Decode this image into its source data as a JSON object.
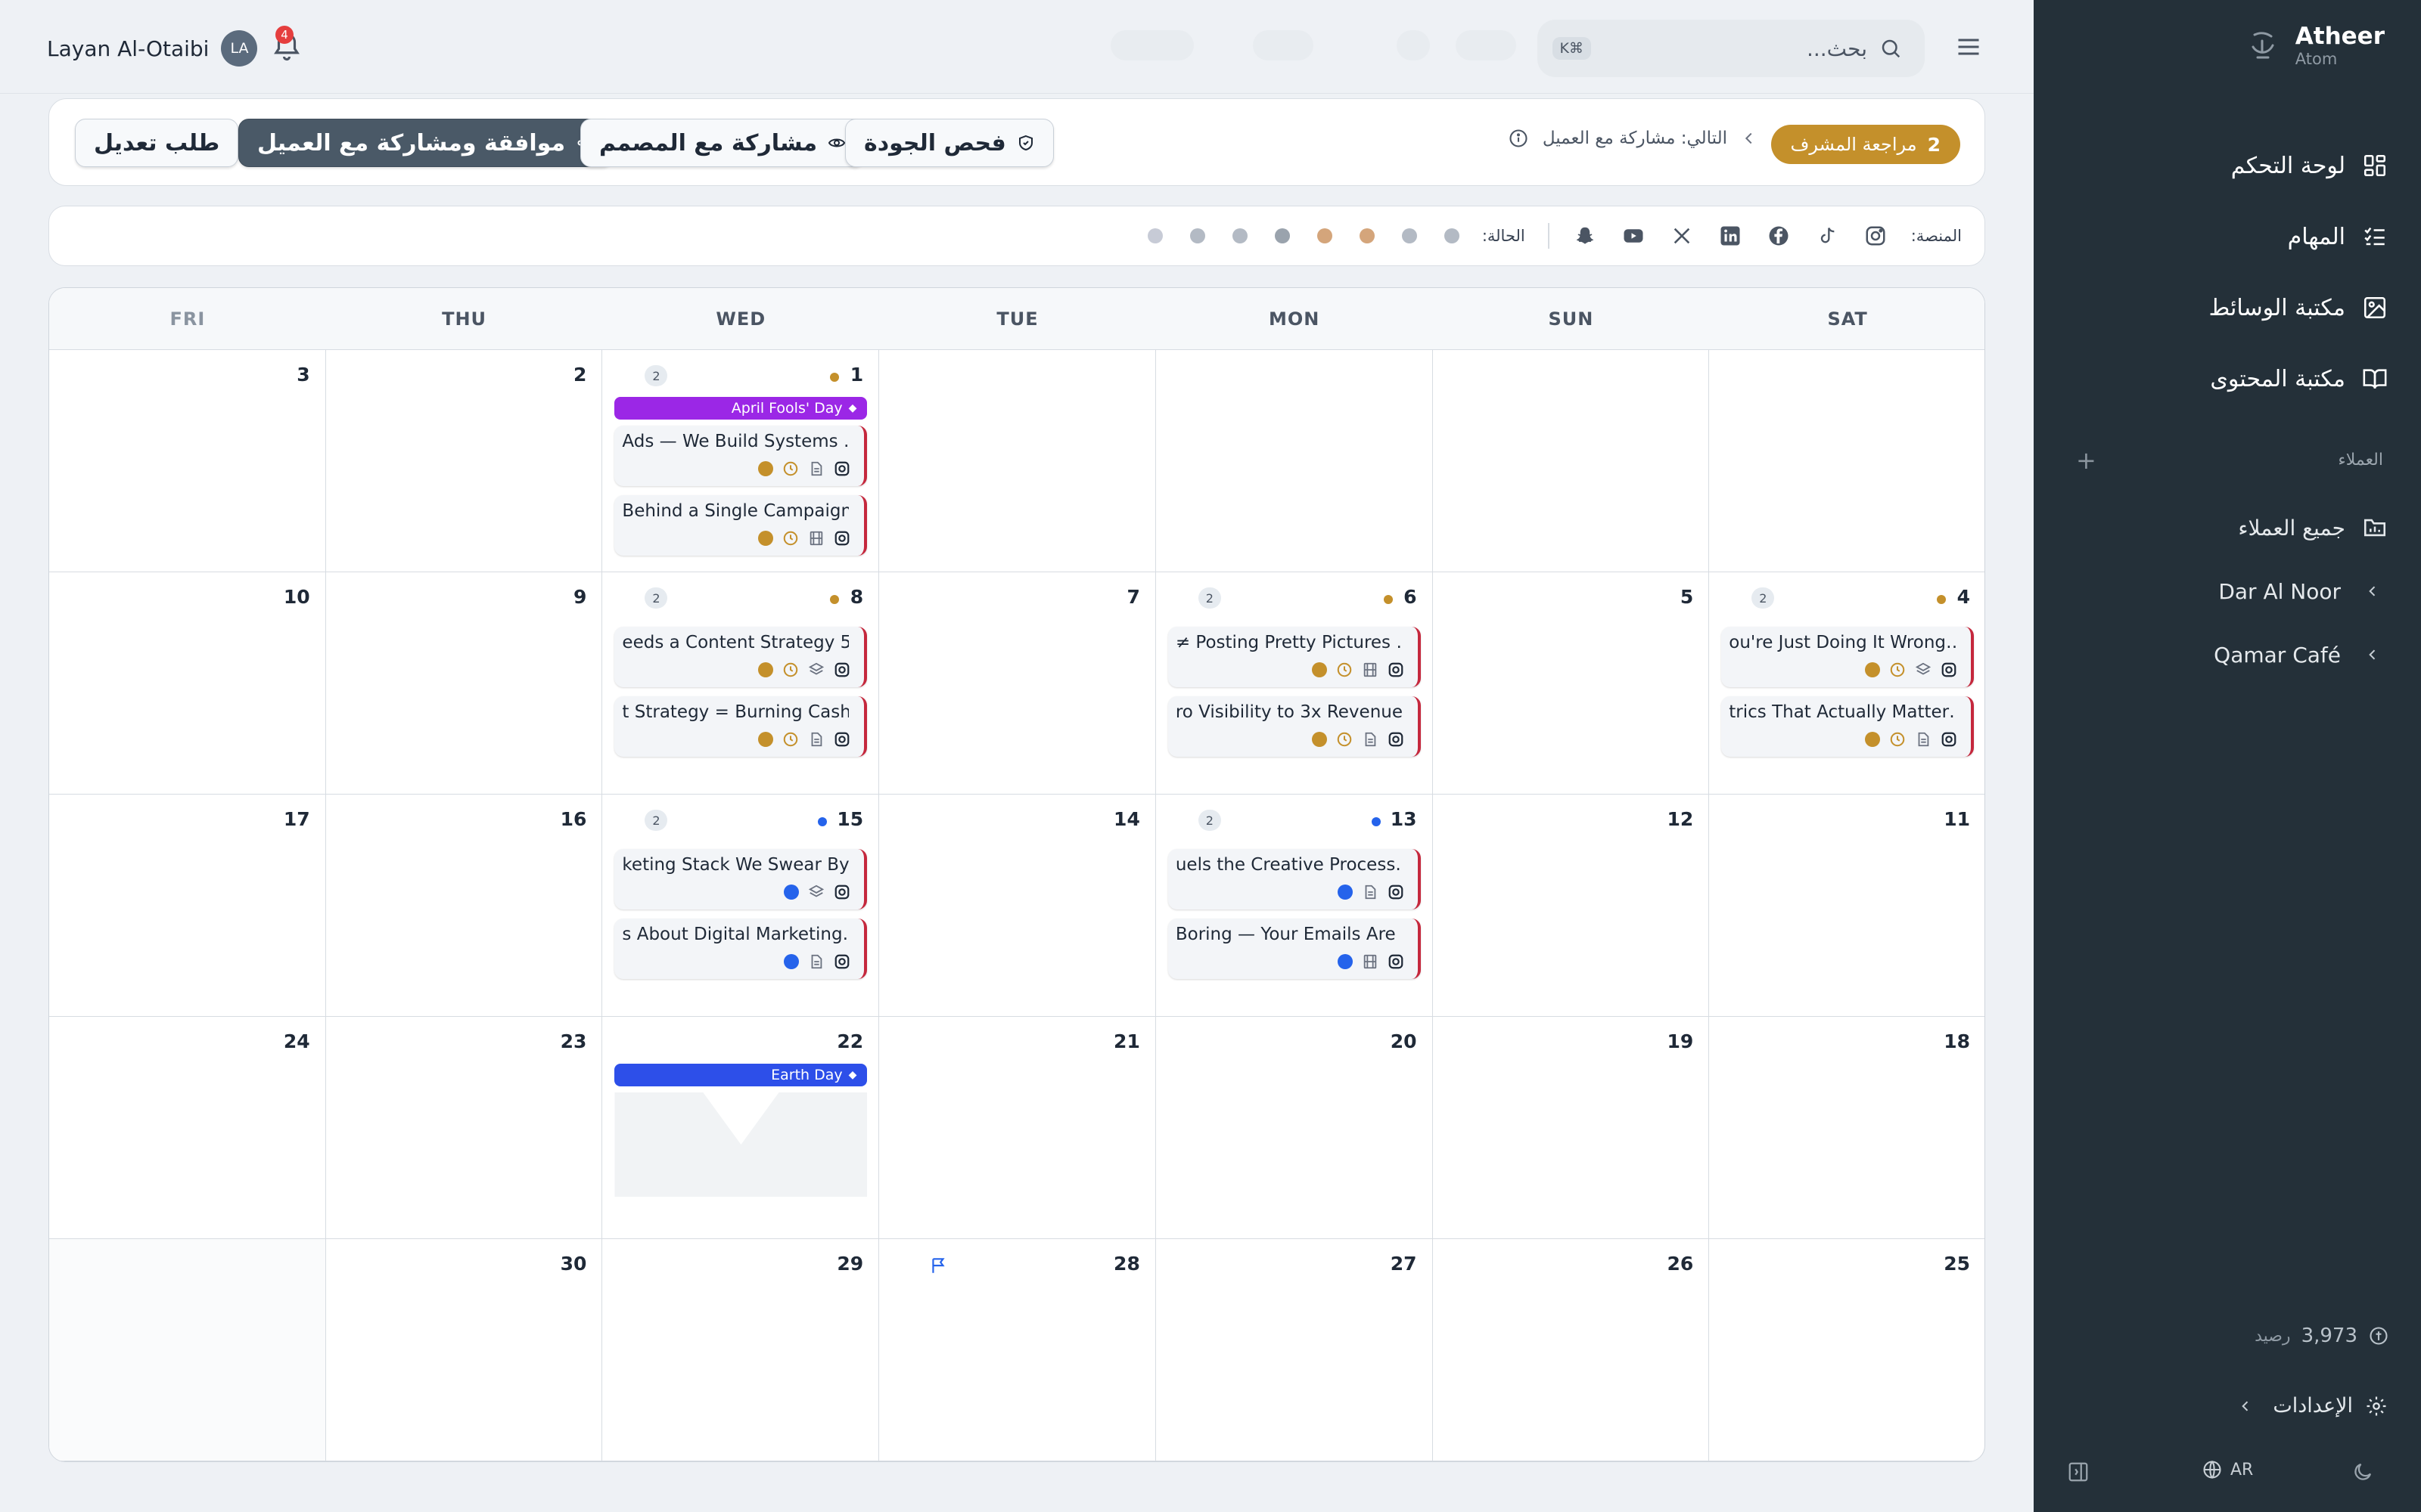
{
  "app": {
    "name": "Atheer",
    "sub": "Atom"
  },
  "nav": [
    "لوحة التحكم",
    "المهام",
    "مكتبة الوسائط",
    "مكتبة المحتوى"
  ],
  "clients_label": "العملاء",
  "clients": [
    "جميع العملاء",
    "Dar Al Noor",
    "Qamar Café"
  ],
  "credit": {
    "value": "3,973",
    "label": "رصيد"
  },
  "settings": "الإعدادات",
  "lang": "AR",
  "user": {
    "name": "Layan Al-Otaibi",
    "initials": "LA",
    "notifications": "4"
  },
  "search": {
    "placeholder": "بحث...",
    "shortcut": "⌘K"
  },
  "workflow": {
    "stage_num": "2",
    "stage_label": "مراجعة المشرف",
    "next": "التالي: مشاركة مع العميل",
    "buttons": {
      "qc": "فحص الجودة",
      "share_designer": "مشاركة مع المصمم",
      "approve": "موافقة ومشاركة مع العميل",
      "revision": "طلب تعديل"
    }
  },
  "filters": {
    "platform_label": "المنصة:",
    "status_label": "الحالة:"
  },
  "status_colors": [
    "#b3bac4",
    "#b3bac4",
    "#d4a57b",
    "#d4a57b",
    "#9aa3ad",
    "#b3bac4",
    "#b3bac4",
    "#c7cbd6"
  ],
  "days": [
    "SAT",
    "SUN",
    "MON",
    "TUE",
    "WED",
    "THU",
    "FRI"
  ],
  "colors": {
    "gold": "#c4902b",
    "blue": "#2563eb",
    "purple": "#9b27e6",
    "holiday_blue": "#2d4fe9"
  },
  "weeks": [
    [
      {
        "d": ""
      },
      {
        "d": ""
      },
      {
        "d": ""
      },
      {
        "d": ""
      },
      {
        "d": "1",
        "dot": "gold",
        "count": "2",
        "holiday": {
          "label": "April Fools' Day",
          "color": "purple"
        },
        "posts": [
          {
            "t": "Ads — We Build Systems …",
            "m": "doc",
            "c": "gold",
            "clock": true
          },
          {
            "t": "Behind a Single Campaign…",
            "m": "film",
            "c": "gold",
            "clock": true
          }
        ]
      },
      {
        "d": "2"
      },
      {
        "d": "3"
      }
    ],
    [
      {
        "d": "4",
        "dot": "gold",
        "count": "2",
        "posts": [
          {
            "t": "ou're Just Doing It Wrong…",
            "m": "layers",
            "c": "gold",
            "clock": true
          },
          {
            "t": "trics That Actually Matter…",
            "m": "doc",
            "c": "gold",
            "clock": true
          }
        ]
      },
      {
        "d": "5"
      },
      {
        "d": "6",
        "dot": "gold",
        "count": "2",
        "posts": [
          {
            "t": "≠ Posting Pretty Pictures …",
            "m": "film",
            "c": "gold",
            "clock": true
          },
          {
            "t": "ro Visibility to 3x Revenue…",
            "m": "doc",
            "c": "gold",
            "clock": true
          }
        ]
      },
      {
        "d": "7"
      },
      {
        "d": "8",
        "dot": "gold",
        "count": "2",
        "posts": [
          {
            "t": "eeds a Content Strategy 5…",
            "m": "layers",
            "c": "gold",
            "clock": true
          },
          {
            "t": "t Strategy = Burning Cash…",
            "m": "doc",
            "c": "gold",
            "clock": true
          }
        ]
      },
      {
        "d": "9"
      },
      {
        "d": "10"
      }
    ],
    [
      {
        "d": "11"
      },
      {
        "d": "12"
      },
      {
        "d": "13",
        "dot": "blue",
        "count": "2",
        "posts": [
          {
            "t": "uels the Creative Process…",
            "m": "doc",
            "c": "blue",
            "clock": false
          },
          {
            "t": "Boring — Your Emails Are …",
            "m": "film",
            "c": "blue",
            "clock": false
          }
        ]
      },
      {
        "d": "14"
      },
      {
        "d": "15",
        "dot": "blue",
        "count": "2",
        "posts": [
          {
            "t": "keting Stack We Swear By…",
            "m": "layers",
            "c": "blue",
            "clock": false
          },
          {
            "t": "s About Digital Marketing…",
            "m": "doc",
            "c": "blue",
            "clock": false
          }
        ]
      },
      {
        "d": "16"
      },
      {
        "d": "17"
      }
    ],
    [
      {
        "d": "18"
      },
      {
        "d": "19"
      },
      {
        "d": "20"
      },
      {
        "d": "21"
      },
      {
        "d": "22",
        "holiday": {
          "label": "Earth Day",
          "color": "holiday_blue"
        },
        "placeholder": true
      },
      {
        "d": "23"
      },
      {
        "d": "24"
      }
    ],
    [
      {
        "d": "25"
      },
      {
        "d": "26"
      },
      {
        "d": "27"
      },
      {
        "d": "28",
        "flag": true
      },
      {
        "d": "29"
      },
      {
        "d": "30"
      },
      {
        "d": "",
        "grey": true
      }
    ]
  ]
}
